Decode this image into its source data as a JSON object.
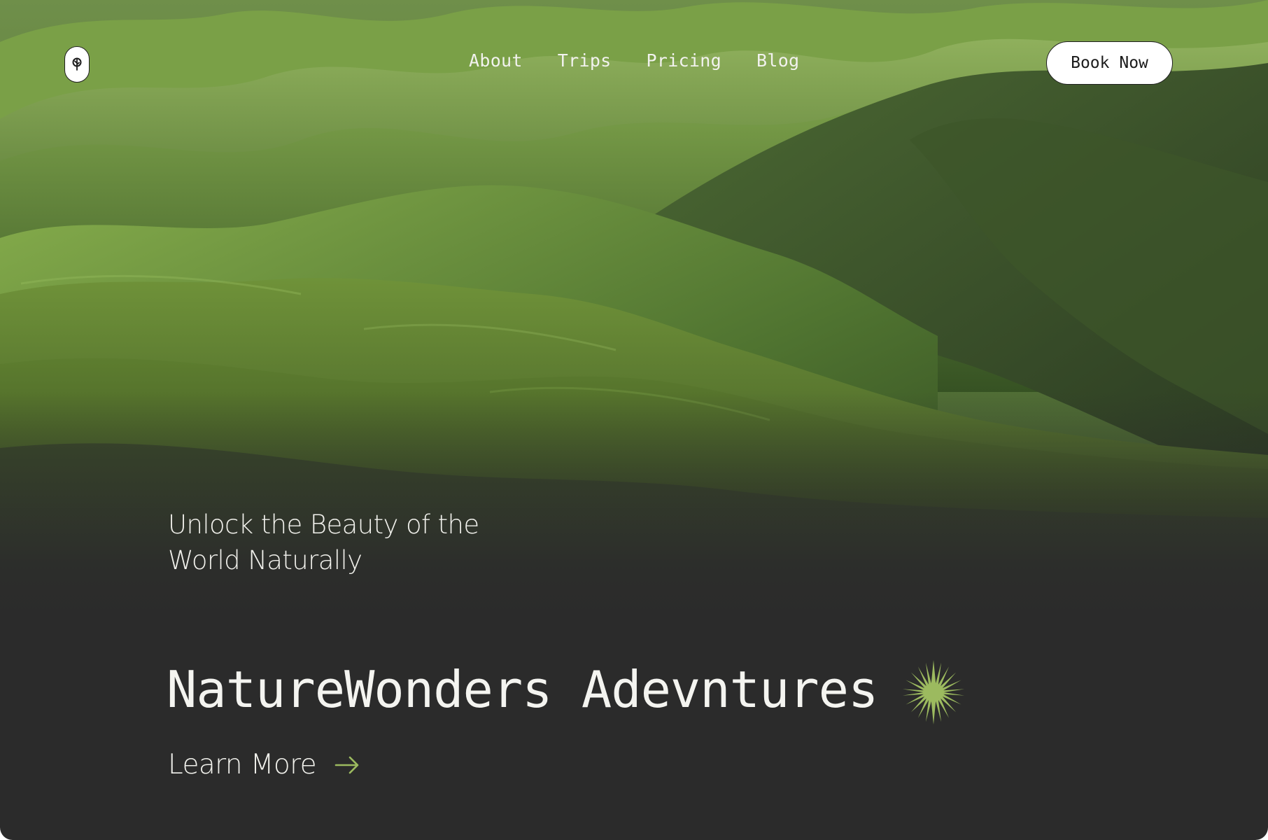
{
  "nav": {
    "links": [
      {
        "label": "About"
      },
      {
        "label": "Trips"
      },
      {
        "label": "Pricing"
      },
      {
        "label": "Blog"
      }
    ],
    "cta_label": "Book Now",
    "logo_icon": "leaf-tree-icon"
  },
  "hero": {
    "tagline": "Unlock the Beauty of the World Naturally",
    "headline": "NatureWonders Adevntures",
    "headline_icon": "starburst-icon",
    "link_label": "Learn More",
    "link_icon": "arrow-right-icon"
  },
  "colors": {
    "background_dark": "#2b2b2b",
    "accent_green": "#9cba5f",
    "text_light": "#f1f1ec",
    "button_bg": "#ffffff"
  }
}
